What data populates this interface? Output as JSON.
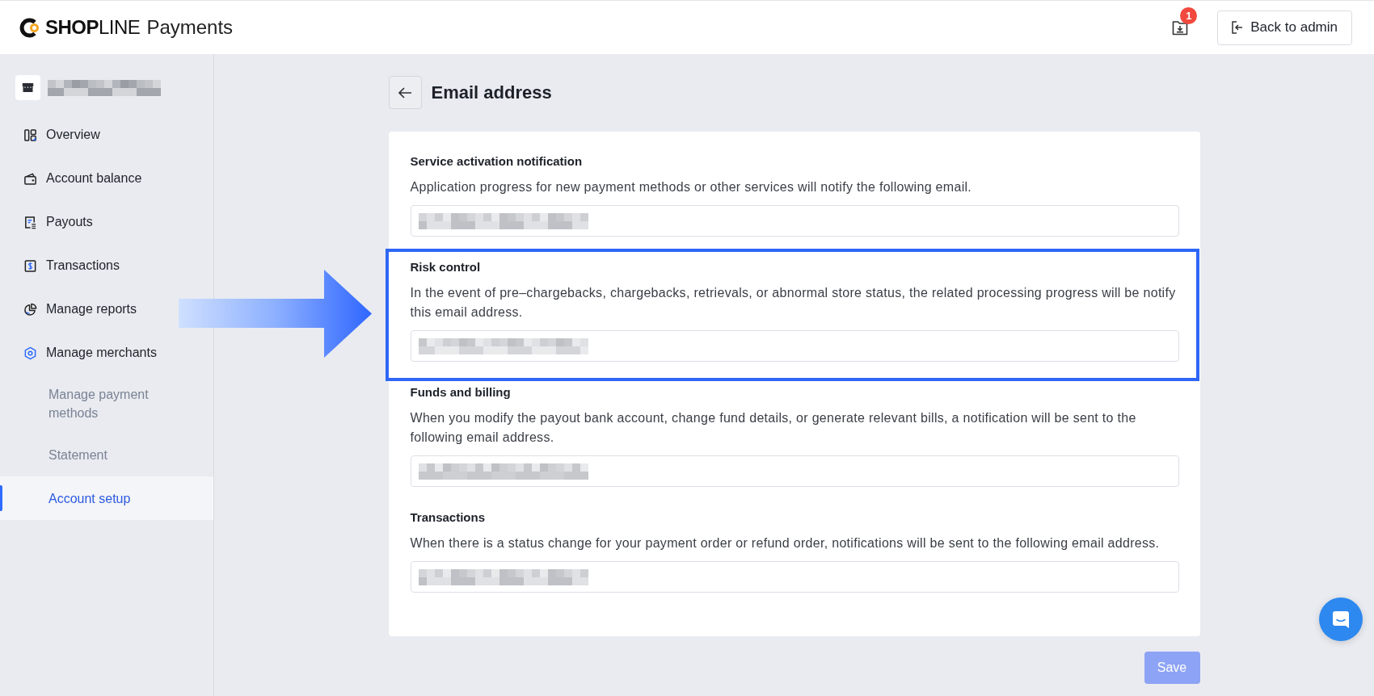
{
  "header": {
    "logo": {
      "brand": "**SHOP**LINE",
      "product": "Payments"
    },
    "downloads_badge": "1",
    "back_button": "Back to admin"
  },
  "sidebar": {
    "store": {
      "name_redacted": true
    },
    "items": [
      {
        "label": "Overview",
        "selected": false
      },
      {
        "label": "Account balance",
        "selected": false
      },
      {
        "label": "Payouts",
        "selected": false
      },
      {
        "label": "Transactions",
        "selected": false
      },
      {
        "label": "Manage reports",
        "selected": false
      },
      {
        "label": "Manage merchants",
        "selected": false,
        "expanded": true,
        "children": [
          {
            "label": "Manage payment methods",
            "selected": false
          },
          {
            "label": "Statement",
            "selected": false
          },
          {
            "label": "Account setup",
            "selected": true
          }
        ]
      }
    ]
  },
  "page": {
    "title": "Email address",
    "sections": [
      {
        "title": "Service activation notification",
        "description": "Application progress for new payment methods or other services will notify the following email.",
        "field": {
          "value_redacted": true
        },
        "highlighted": false
      },
      {
        "title": "Risk control",
        "description": "In the event of pre–chargebacks, chargebacks, retrievals, or abnormal store status, the related processing progress will be notify this email address.",
        "field": {
          "value_redacted": true
        },
        "highlighted": true
      },
      {
        "title": "Funds and billing",
        "description": "When you modify the payout bank account, change fund details, or generate relevant bills, a notification will be sent to the following email address.",
        "field": {
          "value_redacted": true
        },
        "highlighted": false
      },
      {
        "title": "Transactions",
        "description": "When there is a status change for your payment order or refund order, notifications will be sent to the following email address.",
        "field": {
          "value_redacted": true
        },
        "highlighted": false
      }
    ],
    "save_button": {
      "label": "Save",
      "disabled": true
    }
  }
}
